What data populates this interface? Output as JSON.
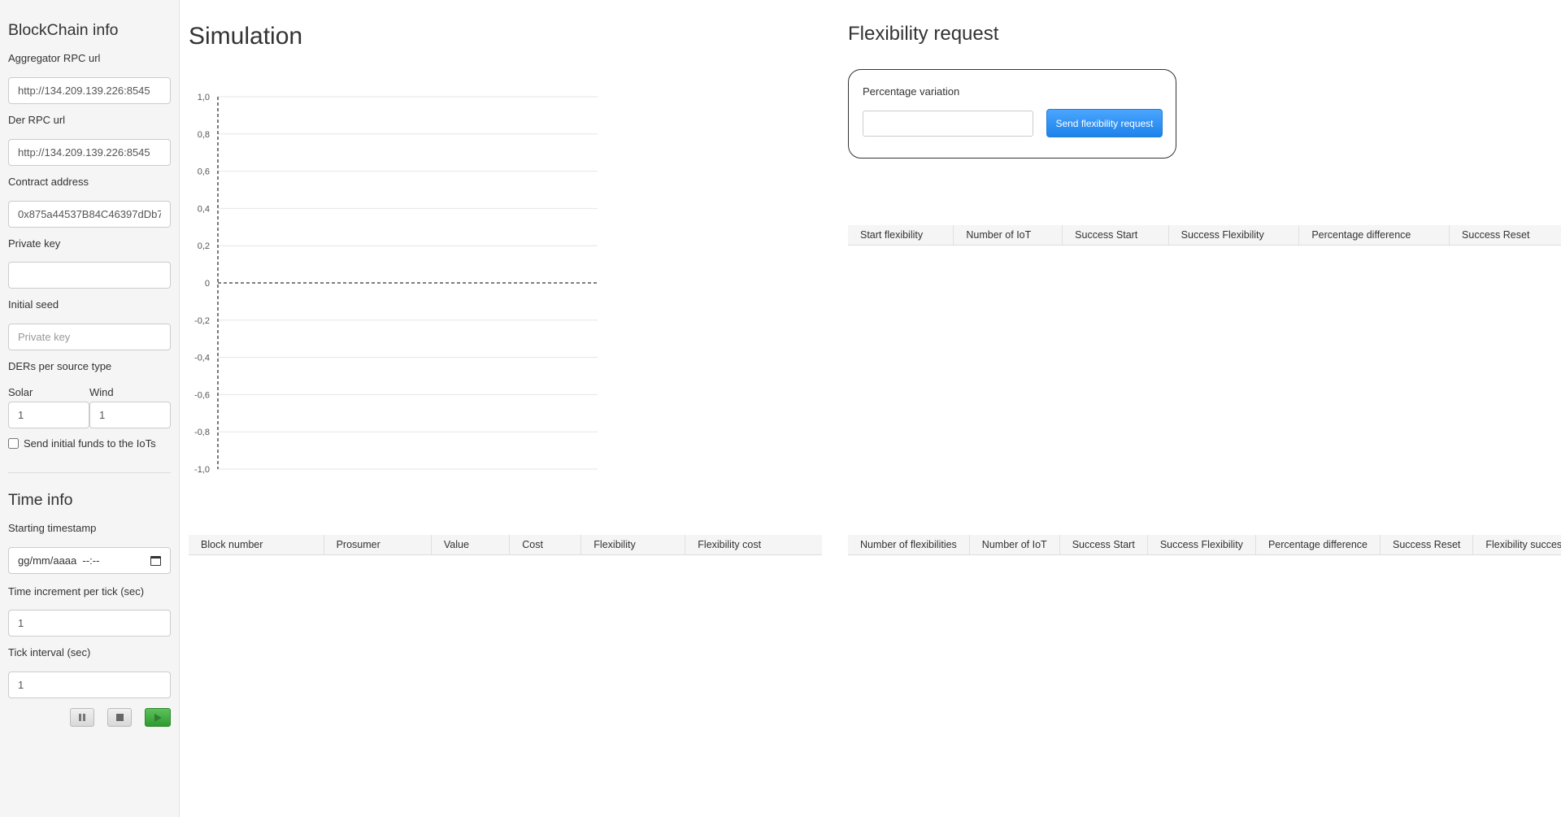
{
  "sidebar": {
    "blockchain_title": "BlockChain info",
    "aggregator_label": "Aggregator RPC url",
    "aggregator_value": "http://134.209.139.226:8545",
    "der_label": "Der RPC url",
    "der_value": "http://134.209.139.226:8545",
    "contract_label": "Contract address",
    "contract_value": "0x875a44537B84C46397dDb7",
    "private_key_label": "Private key",
    "private_key_value": "",
    "initial_seed_label": "Initial seed",
    "initial_seed_placeholder": "Private key",
    "ders_label": "DERs per source type",
    "solar_label": "Solar",
    "solar_value": "1",
    "wind_label": "Wind",
    "wind_value": "1",
    "send_funds_label": "Send initial funds to the IoTs",
    "time_title": "Time info",
    "starting_timestamp_label": "Starting timestamp",
    "starting_timestamp_value": "gg/mm/aaaa  --:--",
    "time_increment_label": "Time increment per tick (sec)",
    "time_increment_value": "1",
    "tick_interval_label": "Tick interval (sec)",
    "tick_interval_value": "1"
  },
  "simulation": {
    "title": "Simulation",
    "table_headers": [
      "Block number",
      "Prosumer",
      "Value",
      "Cost",
      "Flexibility",
      "Flexibility cost"
    ]
  },
  "flexibility": {
    "title": "Flexibility request",
    "percentage_label": "Percentage variation",
    "percentage_value": "",
    "send_button": "Send flexibility request",
    "table1_headers": [
      "Start flexibility",
      "Number of IoT",
      "Success Start",
      "Success Flexibility",
      "Percentage difference",
      "Success Reset"
    ],
    "table2_headers": [
      "Number of flexibilities",
      "Number of IoT",
      "Success Start",
      "Success Flexibility",
      "Percentage difference",
      "Success Reset",
      "Flexibility success"
    ]
  },
  "chart_data": {
    "type": "line",
    "series": [],
    "ylim": [
      -1.0,
      1.0
    ],
    "yticks": [
      "1,0",
      "0,8",
      "0,6",
      "0,4",
      "0,2",
      "0",
      "-0,2",
      "-0,4",
      "-0,6",
      "-0,8",
      "-1,0"
    ],
    "grid": true
  },
  "controls": {
    "pause_icon": "pause-icon",
    "stop_icon": "stop-icon",
    "play_icon": "play-icon"
  }
}
